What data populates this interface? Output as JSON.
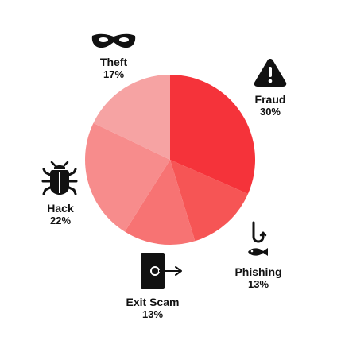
{
  "chart_data": {
    "type": "pie",
    "title": "",
    "start_angle_deg": 0,
    "direction": "clockwise",
    "slices": [
      {
        "label": "Fraud",
        "value": 30,
        "value_label": "30%",
        "color": "#F5333A",
        "icon": "warning-triangle-icon"
      },
      {
        "label": "Phishing",
        "value": 13,
        "value_label": "13%",
        "color": "#F65555",
        "icon": "fishing-hook-icon"
      },
      {
        "label": "Exit Scam",
        "value": 13,
        "value_label": "13%",
        "color": "#F77373",
        "icon": "exit-door-icon"
      },
      {
        "label": "Hack",
        "value": 22,
        "value_label": "22%",
        "color": "#F78C8C",
        "icon": "bug-icon"
      },
      {
        "label": "Theft",
        "value": 17,
        "value_label": "17%",
        "color": "#F6A3A3",
        "icon": "mask-icon"
      }
    ]
  }
}
